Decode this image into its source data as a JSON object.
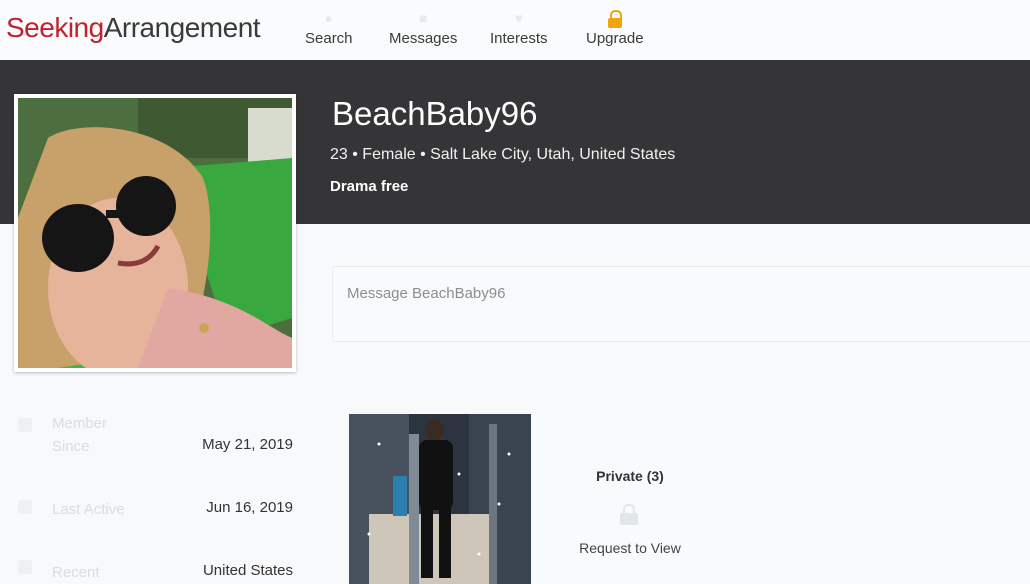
{
  "brand": {
    "part1": "Seeking",
    "part2": "Arrangement"
  },
  "nav": {
    "search": "Search",
    "messages": "Messages",
    "interests": "Interests",
    "upgrade": "Upgrade"
  },
  "profile": {
    "username": "BeachBaby96",
    "age": "23",
    "gender": "Female",
    "location": "Salt Lake City, Utah, United States",
    "subline": "23 • Female • Salt Lake City, Utah, United States",
    "tagline": "Drama free"
  },
  "message": {
    "placeholder": "Message BeachBaby96"
  },
  "details": {
    "member_since_label": "Member Since",
    "member_since_value": "May 21, 2019",
    "last_active_label": "Last Active",
    "last_active_value": "Jun 16, 2019",
    "recent_label": "Recent",
    "recent_value": "United States"
  },
  "gallery": {
    "private_label": "Private (3)",
    "request_label": "Request to View"
  },
  "colors": {
    "brand_red": "#c0222f",
    "hero_bg": "#353537",
    "upgrade_gold": "#f0a410"
  }
}
